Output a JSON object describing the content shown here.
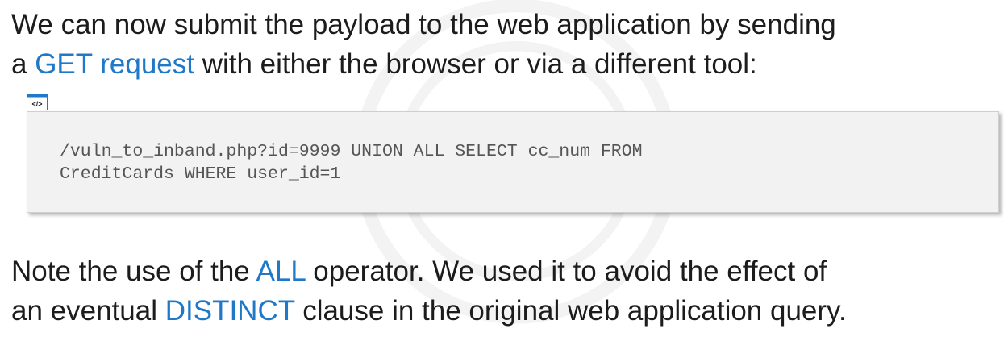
{
  "paragraph1": {
    "text_before": "We can now submit the payload to the web application by sending",
    "line2_start": "a ",
    "highlight": "GET request",
    "line2_end": " with either the browser or via a different tool:"
  },
  "code_block": {
    "icon": "code-icon",
    "line1": "/vuln_to_inband.php?id=9999 UNION ALL SELECT cc_num FROM",
    "line2": "CreditCards WHERE user_id=1"
  },
  "paragraph2": {
    "line1_before": "Note the use of the ",
    "highlight1": "ALL",
    "line1_after": " operator. We used it to avoid the effect of",
    "line2_before": "an eventual ",
    "highlight2": "DISTINCT",
    "line2_after": " clause in the original web application query."
  },
  "colors": {
    "highlight": "#1f78c8",
    "text": "#1c1c1c",
    "code_background": "#f2f2f2"
  }
}
